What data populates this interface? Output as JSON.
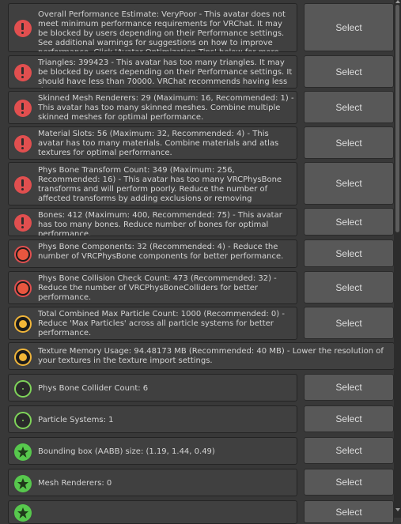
{
  "colors": {
    "background": "#383838",
    "message_bg": "#404040",
    "button_bg": "#585858",
    "error_red": "#e14f4f",
    "warning_yellow": "#f2b637",
    "ok_green": "#57c84d"
  },
  "select_label": "Select",
  "items": [
    {
      "icon": "error",
      "text": "Overall Performance Estimate: VeryPoor - This avatar does not meet minimum performance requirements for VRChat. It may be blocked by users depending on their Performance settings. See additional warnings for suggestions on how to improve performance. Click 'Avatar Optimization Tips' below for more information.",
      "has_button": true
    },
    {
      "icon": "error",
      "text": "Triangles: 399423 - This avatar has too many triangles. It may be blocked by users depending on their Performance settings. It should have less than 70000. VRChat recommends having less than 32000.",
      "has_button": true
    },
    {
      "icon": "error",
      "text": "Skinned Mesh Renderers: 29 (Maximum: 16, Recommended: 1) - This avatar has too many skinned meshes. Combine multiple skinned meshes for optimal performance.",
      "has_button": true
    },
    {
      "icon": "error",
      "text": "Material Slots: 56 (Maximum: 32, Recommended: 4) - This avatar has too many materials. Combine materials and atlas textures for optimal performance.",
      "has_button": true
    },
    {
      "icon": "error",
      "text": "Phys Bone Transform Count: 349 (Maximum: 256, Recommended: 16) - This avatar has too many VRCPhysBone transforms and will perform poorly. Reduce the number of affected transforms by adding exclusions or removing components.",
      "has_button": true
    },
    {
      "icon": "error",
      "text": "Bones: 412 (Maximum: 400, Recommended: 75) - This avatar has too many bones. Reduce number of bones for optimal performance.",
      "has_button": true
    },
    {
      "icon": "red-dot",
      "text": "Phys Bone Components: 32 (Recommended: 4) - Reduce the number of VRCPhysBone components for better performance.",
      "has_button": true
    },
    {
      "icon": "red-dot",
      "text": "Phys Bone Collision Check Count: 473 (Recommended: 32) - Reduce the number of VRCPhysBoneColliders for better performance.",
      "has_button": true
    },
    {
      "icon": "yellow-dot",
      "text": "Total Combined Max Particle Count: 1000 (Recommended: 0) - Reduce 'Max Particles' across all particle systems for better performance.",
      "has_button": true
    },
    {
      "icon": "yellow-dot",
      "text": "Texture Memory Usage: 94.48173 MB (Recommended: 40 MB) - Lower the resolution of your textures in the texture import settings.",
      "has_button": false
    },
    {
      "icon": "green-dot",
      "text": "Phys Bone Collider Count: 6",
      "has_button": true
    },
    {
      "icon": "green-dot",
      "text": "Particle Systems: 1",
      "has_button": true
    },
    {
      "icon": "green-star",
      "text": "Bounding box (AABB) size: (1.19, 1.44, 0.49)",
      "has_button": true
    },
    {
      "icon": "green-star",
      "text": "Mesh Renderers: 0",
      "has_button": true
    },
    {
      "icon": "green-star",
      "text": "",
      "has_button": true
    }
  ]
}
